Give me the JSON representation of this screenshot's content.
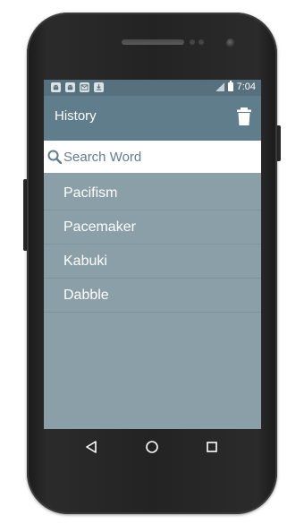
{
  "status_bar": {
    "time": "7:04",
    "notification_icons": [
      "android-icon",
      "android-icon",
      "gmail-icon",
      "download-icon"
    ]
  },
  "app_bar": {
    "title": "History",
    "action_icon": "trash-icon"
  },
  "search": {
    "placeholder": "Search Word",
    "value": ""
  },
  "history": {
    "items": [
      {
        "label": "Pacifism"
      },
      {
        "label": "Pacemaker"
      },
      {
        "label": "Kabuki"
      },
      {
        "label": "Dabble"
      }
    ]
  },
  "nav": {
    "buttons": [
      "back-icon",
      "home-icon",
      "recents-icon"
    ]
  },
  "colors": {
    "status_bar": "#56707d",
    "app_bar": "#607d8b",
    "list_background": "#8a9fa8",
    "divider": "#7f939c",
    "text_on_dark": "#ffffff"
  }
}
